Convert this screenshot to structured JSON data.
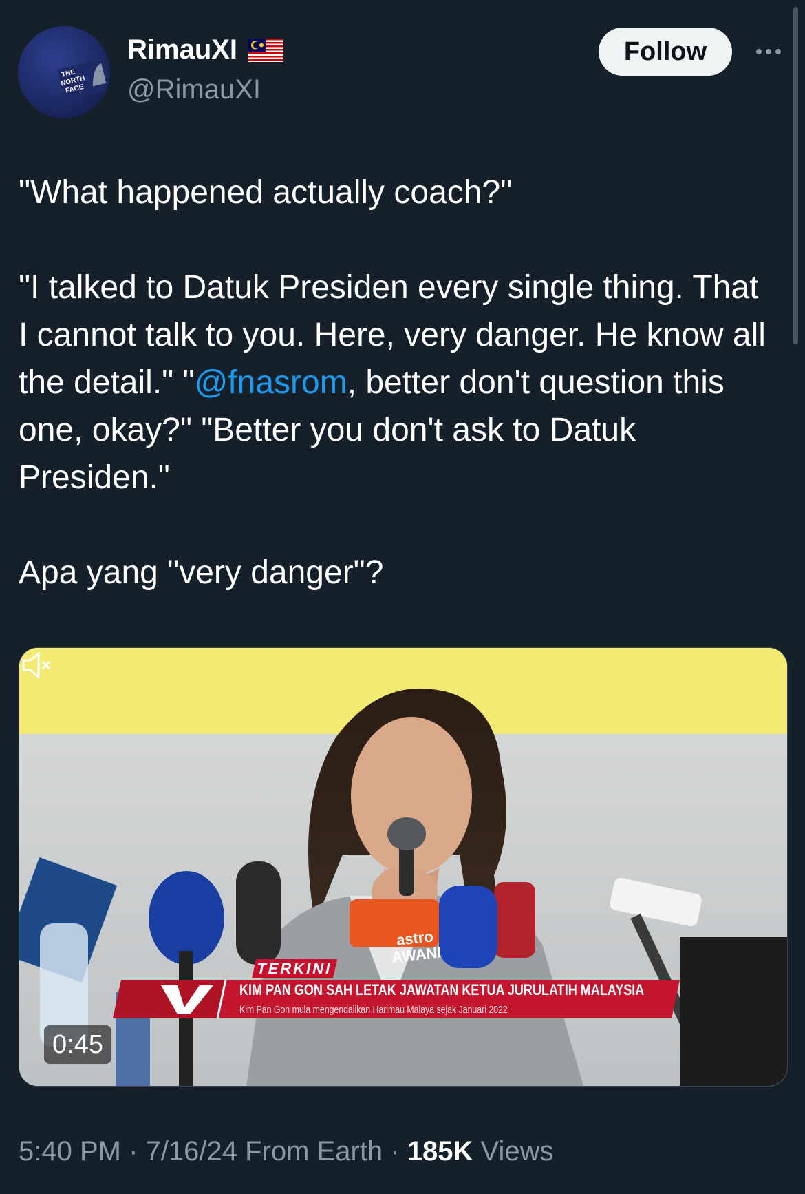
{
  "author": {
    "display_name": "RimauXI",
    "handle": "@RimauXI",
    "flag_icon": "malaysia-flag-icon",
    "avatar_cap_text": "THE NORTH FACE"
  },
  "actions": {
    "follow_label": "Follow",
    "more_icon": "more-options-icon"
  },
  "tweet": {
    "line1": "\"What happened actually coach?\"",
    "para2_before_mention": "\"I talked to Datuk Presiden every single thing. That I cannot talk to you. Here, very danger. He know all the detail.\" \"",
    "mention": "@fnasrom",
    "para2_after_mention": ", better don't question this one, okay?\" \"Better you don't ask to Datuk Presiden.\"",
    "line3": "Apa yang \"very danger\"?"
  },
  "media": {
    "duration": "0:45",
    "mute_icon": "mute-icon",
    "ticker_tag": "TERKINI",
    "ticker_headline": "KIM PAN GON SAH LETAK JAWATAN KETUA JURULATIH MALAYSIA",
    "ticker_sub": "Kim Pan Gon mula mengendalikan Harimau Malaya sejak Januari 2022",
    "mic_label": "astro AWANI"
  },
  "footer": {
    "time": "5:40 PM",
    "date": "7/16/24",
    "source": "From Earth",
    "views_count": "185K",
    "views_label": "Views",
    "separator": "·"
  },
  "colors": {
    "background": "#15202b",
    "text_primary": "#ffffff",
    "text_secondary": "#8b98a5",
    "mention": "#1d9bf0",
    "follow_bg": "#eff3f4"
  }
}
